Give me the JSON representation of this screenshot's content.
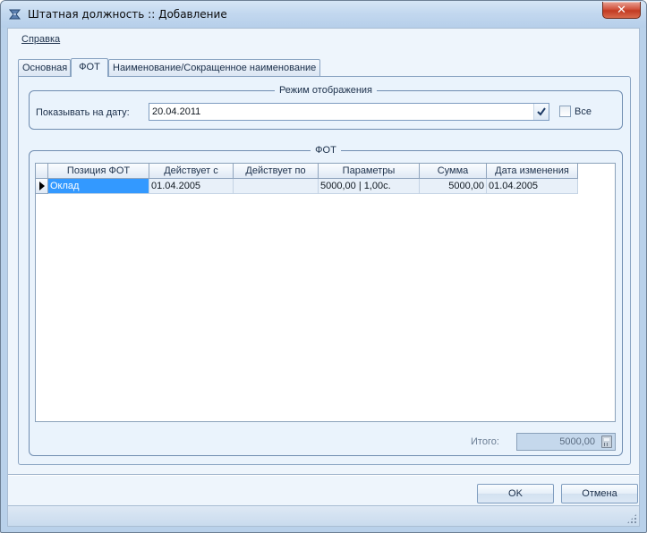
{
  "window": {
    "title": "Штатная должность :: Добавление",
    "close_glyph": "✕"
  },
  "menu": {
    "help": "Справка"
  },
  "tabs": [
    {
      "label": "Основная"
    },
    {
      "label": "ФОТ"
    },
    {
      "label": "Наименование/Сокращенное наименование"
    }
  ],
  "active_tab": "ФОТ",
  "display_mode": {
    "title": "Режим отображения",
    "date_label": "Показывать на дату:",
    "date_value": "20.04.2011",
    "all_label": "Все"
  },
  "fot": {
    "title": "ФОТ",
    "columns": [
      "Позиция ФОТ",
      "Действует с",
      "Действует по",
      "Параметры",
      "Сумма",
      "Дата изменения"
    ],
    "rows": [
      [
        "Оклад",
        "01.04.2005",
        "",
        "5000,00 | 1,00с.",
        "5000,00",
        "01.04.2005"
      ]
    ],
    "total_label": "Итого:",
    "total_value": "5000,00"
  },
  "buttons": {
    "ok": "OK",
    "cancel": "Отмена"
  },
  "colors": {
    "selection": "#3399ff",
    "client_bg": "#eef5fc",
    "frame_border": "#6f8cb0"
  }
}
